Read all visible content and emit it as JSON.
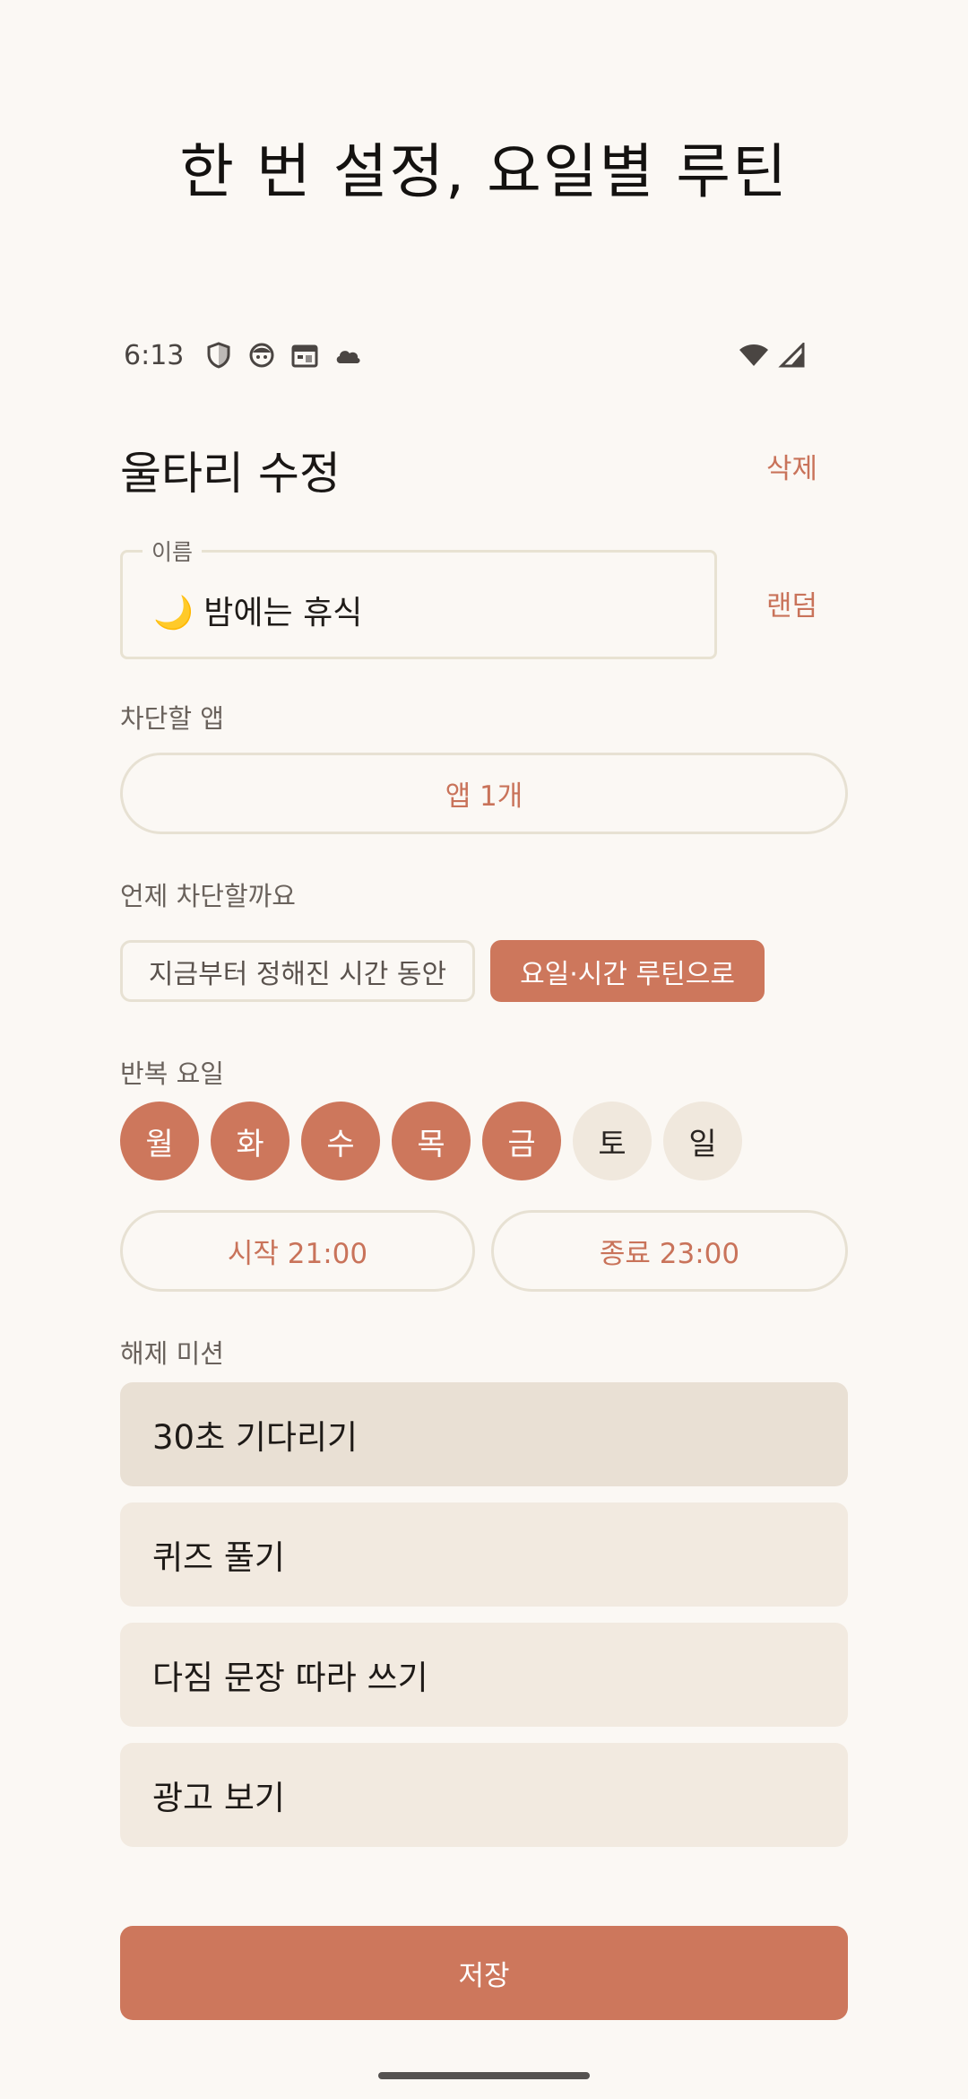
{
  "headline": "한 번 설정, 요일별 루틴",
  "status_bar": {
    "time": "6:13",
    "left_icons": [
      "shield-icon",
      "face-icon",
      "calendar-icon",
      "cloud-icon"
    ],
    "right_icons": [
      "wifi-icon",
      "signal-icon"
    ]
  },
  "screen": {
    "title": "울타리 수정",
    "delete_label": "삭제",
    "random_label": "랜덤"
  },
  "name_field": {
    "label": "이름",
    "value": "🌙 밤에는 휴식"
  },
  "apps_section": {
    "label": "차단할 앱",
    "button": "앱 1개"
  },
  "when_section": {
    "label": "언제 차단할까요",
    "options": [
      {
        "label": "지금부터 정해진 시간 동안",
        "selected": false
      },
      {
        "label": "요일·시간 루틴으로",
        "selected": true
      }
    ]
  },
  "repeat_section": {
    "label": "반복 요일",
    "days": [
      {
        "label": "월",
        "selected": true
      },
      {
        "label": "화",
        "selected": true
      },
      {
        "label": "수",
        "selected": true
      },
      {
        "label": "목",
        "selected": true
      },
      {
        "label": "금",
        "selected": true
      },
      {
        "label": "토",
        "selected": false
      },
      {
        "label": "일",
        "selected": false
      }
    ]
  },
  "time_range": {
    "start": "시작 21:00",
    "end": "종료 23:00"
  },
  "mission_section": {
    "label": "해제 미션",
    "options": [
      {
        "label": "30초 기다리기",
        "selected": true
      },
      {
        "label": "퀴즈 풀기",
        "selected": false
      },
      {
        "label": "다짐 문장 따라 쓰기",
        "selected": false
      },
      {
        "label": "광고 보기",
        "selected": false
      }
    ]
  },
  "save_label": "저장",
  "colors": {
    "accent": "#CD775C",
    "background": "#FBF8F4",
    "chip_off": "#F0E8DD",
    "mission_bg": "#F2EAE0",
    "mission_selected_bg": "#E9E0D4"
  }
}
